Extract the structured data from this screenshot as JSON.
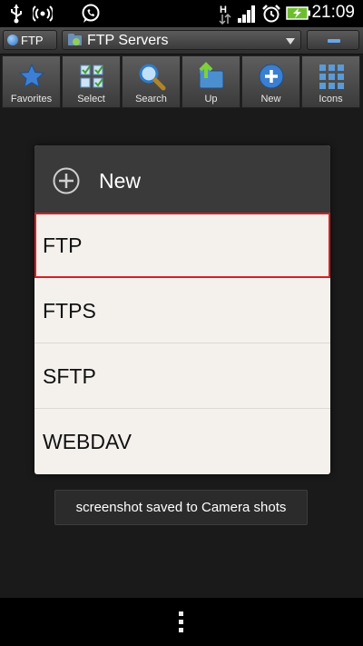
{
  "status_bar": {
    "time": "21:09",
    "icons": [
      "usb-icon",
      "wifi-hotspot-icon",
      "whatsapp-icon",
      "hsdpa-data-icon",
      "signal-icon",
      "alarm-icon",
      "battery-charging-icon"
    ]
  },
  "location_bar": {
    "protocol_label": "FTP",
    "path_label": "FTP Servers"
  },
  "toolbar": {
    "items": [
      {
        "label": "Favorites",
        "icon": "star-icon"
      },
      {
        "label": "Select",
        "icon": "select-grid-icon"
      },
      {
        "label": "Search",
        "icon": "magnifier-icon"
      },
      {
        "label": "Up",
        "icon": "folder-up-icon"
      },
      {
        "label": "New",
        "icon": "plus-circle-icon"
      },
      {
        "label": "Icons",
        "icon": "icons-grid-icon"
      }
    ]
  },
  "dialog": {
    "title": "New",
    "options": [
      "FTP",
      "FTPS",
      "SFTP",
      "WEBDAV"
    ],
    "selected": "FTP"
  },
  "toast": {
    "message": "screenshot saved to Camera shots"
  },
  "colors": {
    "selection_border": "#d61f25",
    "dialog_bg": "#f4f1ed",
    "header_bg": "#3a3a3a",
    "accent_blue": "#3a7fd0"
  }
}
